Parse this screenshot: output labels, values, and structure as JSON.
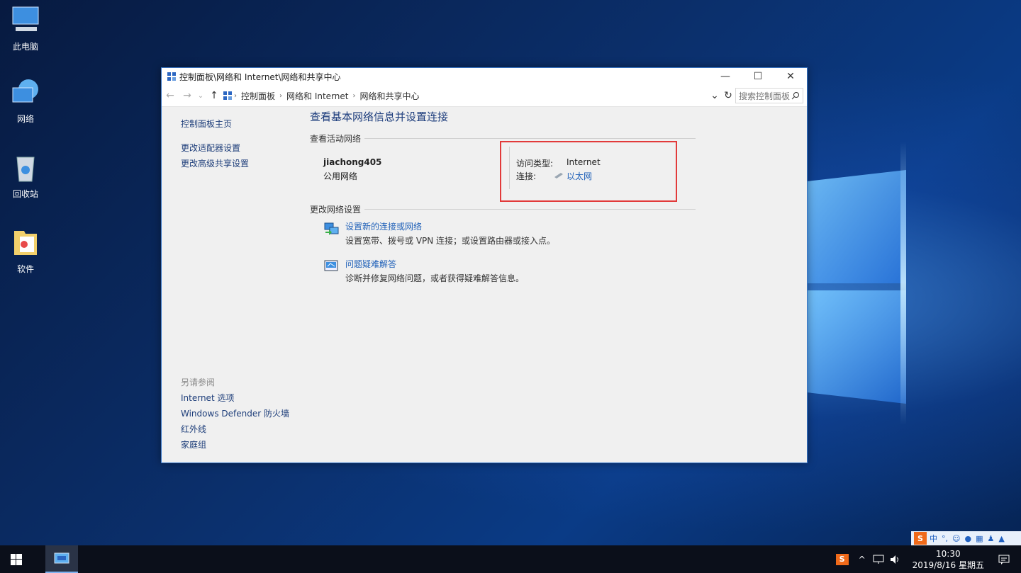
{
  "desktop": {
    "icons": [
      {
        "label": "此电脑",
        "icon": "computer-icon"
      },
      {
        "label": "网络",
        "icon": "network-globe-icon"
      },
      {
        "label": "回收站",
        "icon": "recycle-bin-icon"
      },
      {
        "label": "软件",
        "icon": "folder-icon"
      }
    ]
  },
  "window": {
    "title": "控制面板\\网络和 Internet\\网络和共享中心",
    "minimize": "—",
    "maximize": "☐",
    "close": "✕",
    "address": {
      "back": "←",
      "forward": "→",
      "recent": "⌄",
      "up": "↑",
      "crumbs": [
        "控制面板",
        "网络和 Internet",
        "网络和共享中心"
      ],
      "crumb_sep": "›",
      "dropdown": "⌄",
      "refresh": "↻",
      "search_placeholder": "搜索控制面板"
    },
    "sidebar": {
      "home": "控制面板主页",
      "adapter": "更改适配器设置",
      "advanced": "更改高级共享设置",
      "see_also": "另请参阅",
      "internet_options": "Internet 选项",
      "firewall": "Windows Defender 防火墙",
      "infrared": "红外线",
      "homegroup": "家庭组"
    },
    "main": {
      "title": "查看基本网络信息并设置连接",
      "active_networks_heading": "查看活动网络",
      "network_name": "jiachong405",
      "network_type": "公用网络",
      "access_type_label": "访问类型:",
      "access_type_value": "Internet",
      "connection_label": "连接:",
      "connection_value": "以太网",
      "change_settings_heading": "更改网络设置",
      "tasks": [
        {
          "link": "设置新的连接或网络",
          "desc": "设置宽带、拨号或 VPN 连接；或设置路由器或接入点。",
          "icon": "new-connection-icon"
        },
        {
          "link": "问题疑难解答",
          "desc": "诊断并修复网络问题，或者获得疑难解答信息。",
          "icon": "troubleshoot-icon"
        }
      ]
    }
  },
  "taskbar": {
    "time": "10:30",
    "date": "2019/8/16 星期五",
    "ime": {
      "lang": "中",
      "punct": "°,"
    },
    "tray_chevron": "^"
  }
}
